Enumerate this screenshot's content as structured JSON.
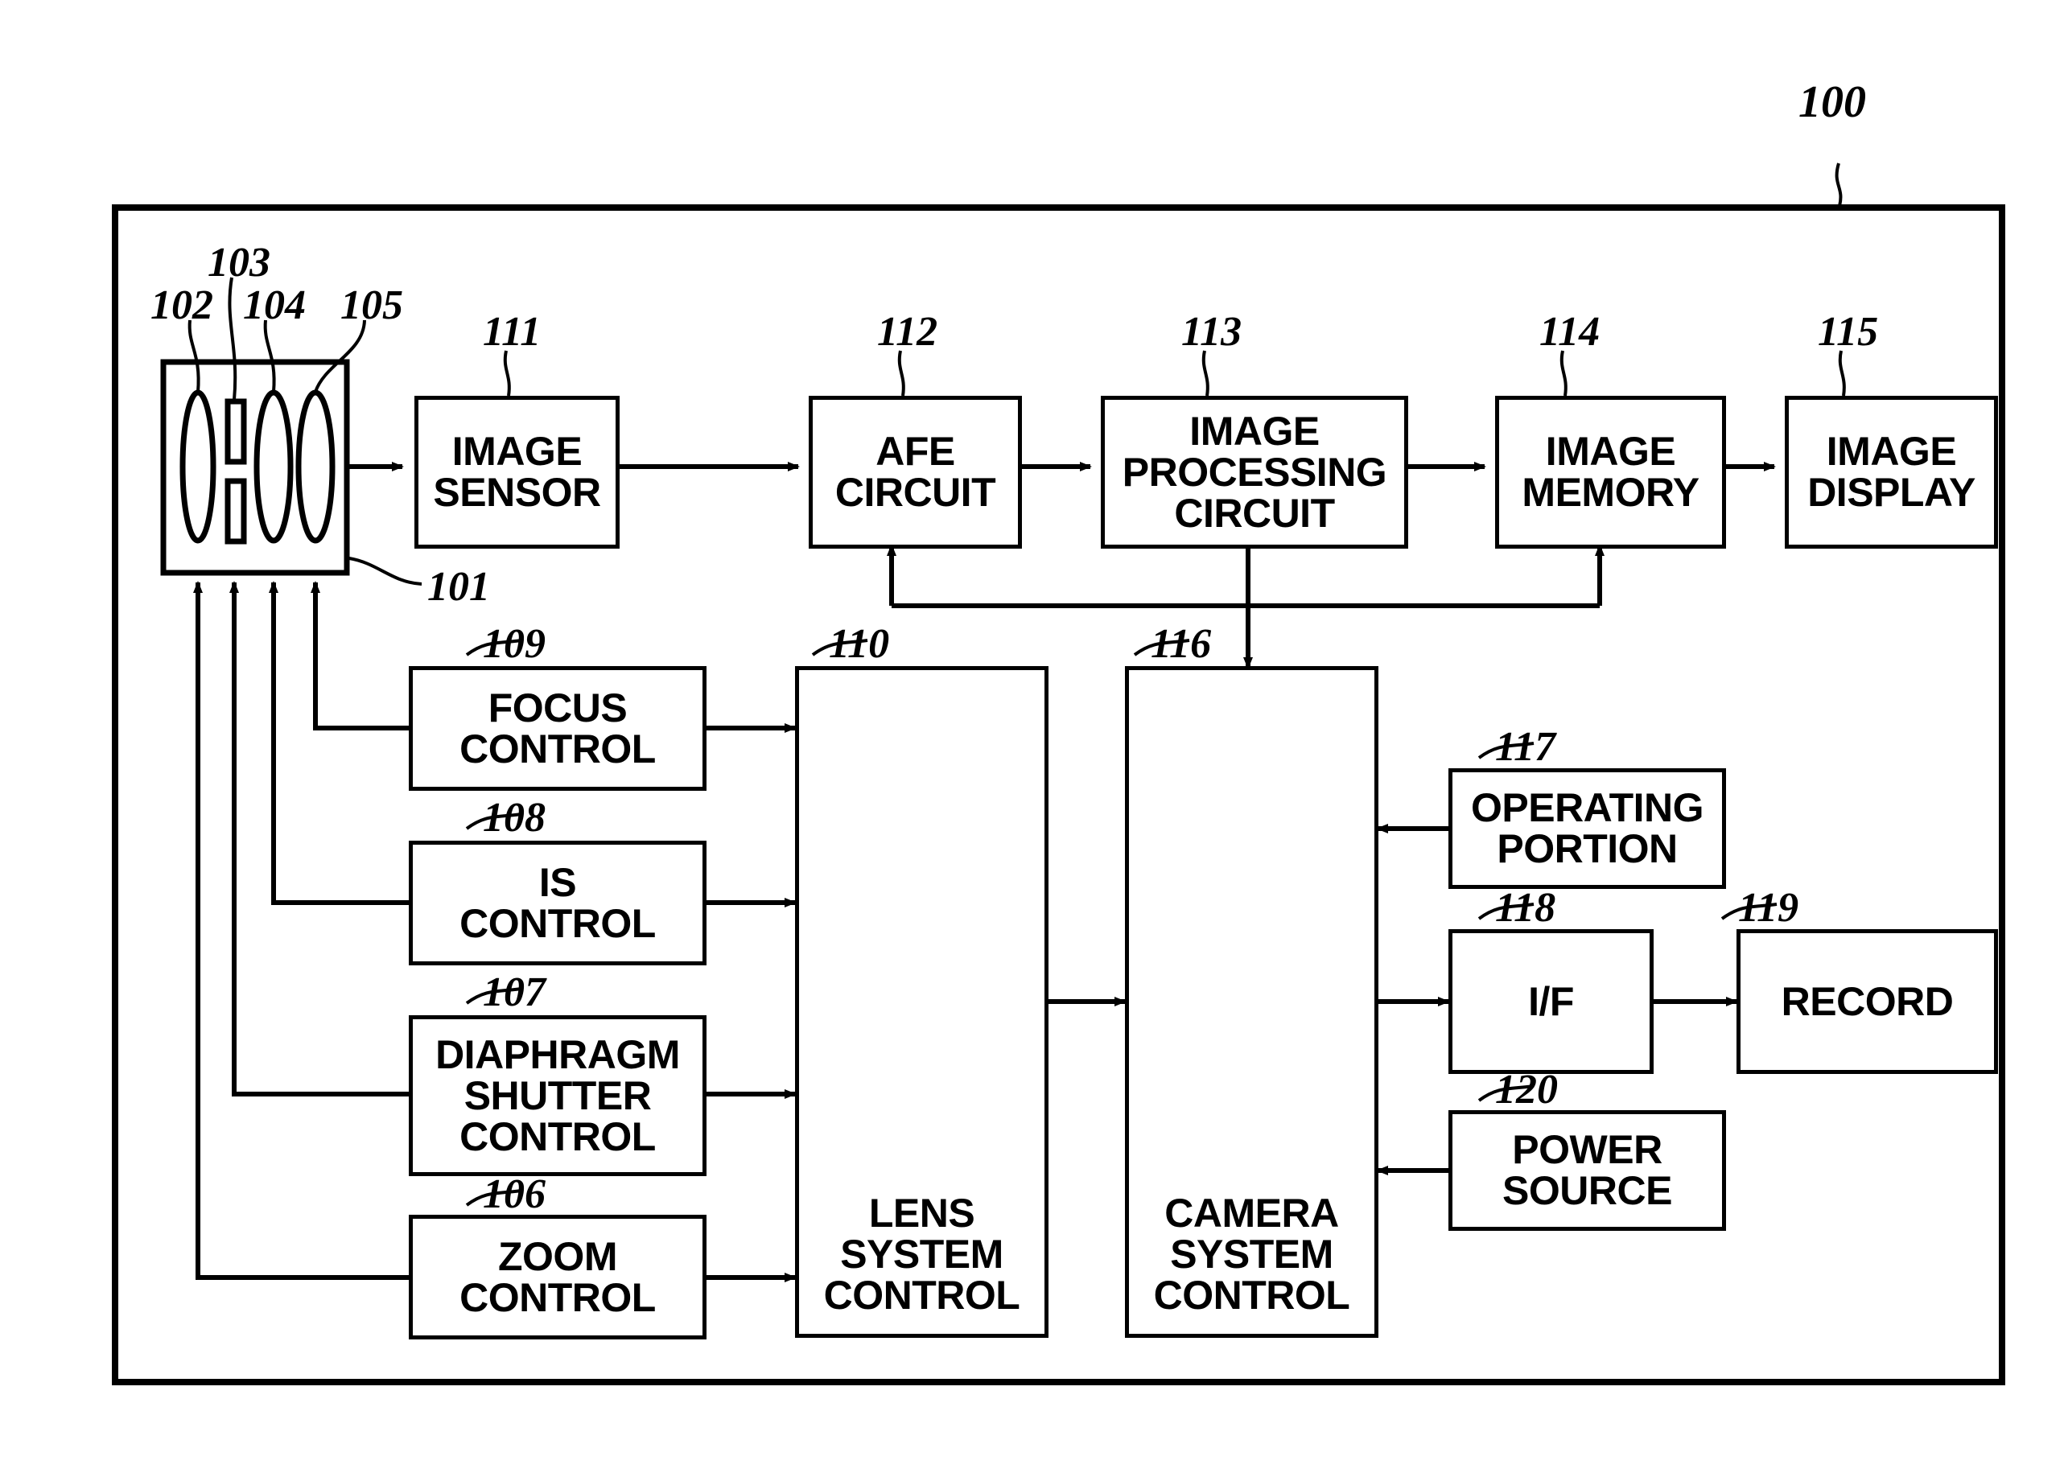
{
  "figure": {
    "type": "patent-block-diagram",
    "title": "Camera system block diagram",
    "outer_frame_ref": "100"
  },
  "optics": {
    "assembly_ref": "101",
    "elements": [
      {
        "ref": "102",
        "kind": "lens"
      },
      {
        "ref": "103",
        "kind": "diaphragm-shutter"
      },
      {
        "ref": "104",
        "kind": "lens"
      },
      {
        "ref": "105",
        "kind": "lens"
      }
    ]
  },
  "blocks": [
    {
      "id": "image_sensor",
      "ref": "111",
      "lines": [
        "IMAGE",
        "SENSOR"
      ]
    },
    {
      "id": "afe_circuit",
      "ref": "112",
      "lines": [
        "AFE",
        "CIRCUIT"
      ]
    },
    {
      "id": "image_processing",
      "ref": "113",
      "lines": [
        "IMAGE",
        "PROCESSING",
        "CIRCUIT"
      ]
    },
    {
      "id": "image_memory",
      "ref": "114",
      "lines": [
        "IMAGE",
        "MEMORY"
      ]
    },
    {
      "id": "image_display",
      "ref": "115",
      "lines": [
        "IMAGE",
        "DISPLAY"
      ]
    },
    {
      "id": "focus_control",
      "ref": "109",
      "lines": [
        "FOCUS",
        "CONTROL"
      ]
    },
    {
      "id": "is_control",
      "ref": "108",
      "lines": [
        "IS",
        "CONTROL"
      ]
    },
    {
      "id": "diaphragm_control",
      "ref": "107",
      "lines": [
        "DIAPHRAGM",
        "SHUTTER",
        "CONTROL"
      ]
    },
    {
      "id": "zoom_control",
      "ref": "106",
      "lines": [
        "ZOOM",
        "CONTROL"
      ]
    },
    {
      "id": "lens_system",
      "ref": "110",
      "lines": [
        "LENS",
        "SYSTEM",
        "CONTROL"
      ]
    },
    {
      "id": "camera_system",
      "ref": "116",
      "lines": [
        "CAMERA",
        "SYSTEM",
        "CONTROL"
      ]
    },
    {
      "id": "operating_portion",
      "ref": "117",
      "lines": [
        "OPERATING",
        "PORTION"
      ]
    },
    {
      "id": "interface",
      "ref": "118",
      "lines": [
        "I/F"
      ]
    },
    {
      "id": "record",
      "ref": "119",
      "lines": [
        "RECORD"
      ]
    },
    {
      "id": "power_source",
      "ref": "120",
      "lines": [
        "POWER",
        "SOURCE"
      ]
    }
  ],
  "reference_numerals": [
    "100",
    "101",
    "102",
    "103",
    "104",
    "105",
    "106",
    "107",
    "108",
    "109",
    "110",
    "111",
    "112",
    "113",
    "114",
    "115",
    "116",
    "117",
    "118",
    "119",
    "120"
  ],
  "colors": {
    "line": "#000000",
    "background": "#ffffff"
  }
}
